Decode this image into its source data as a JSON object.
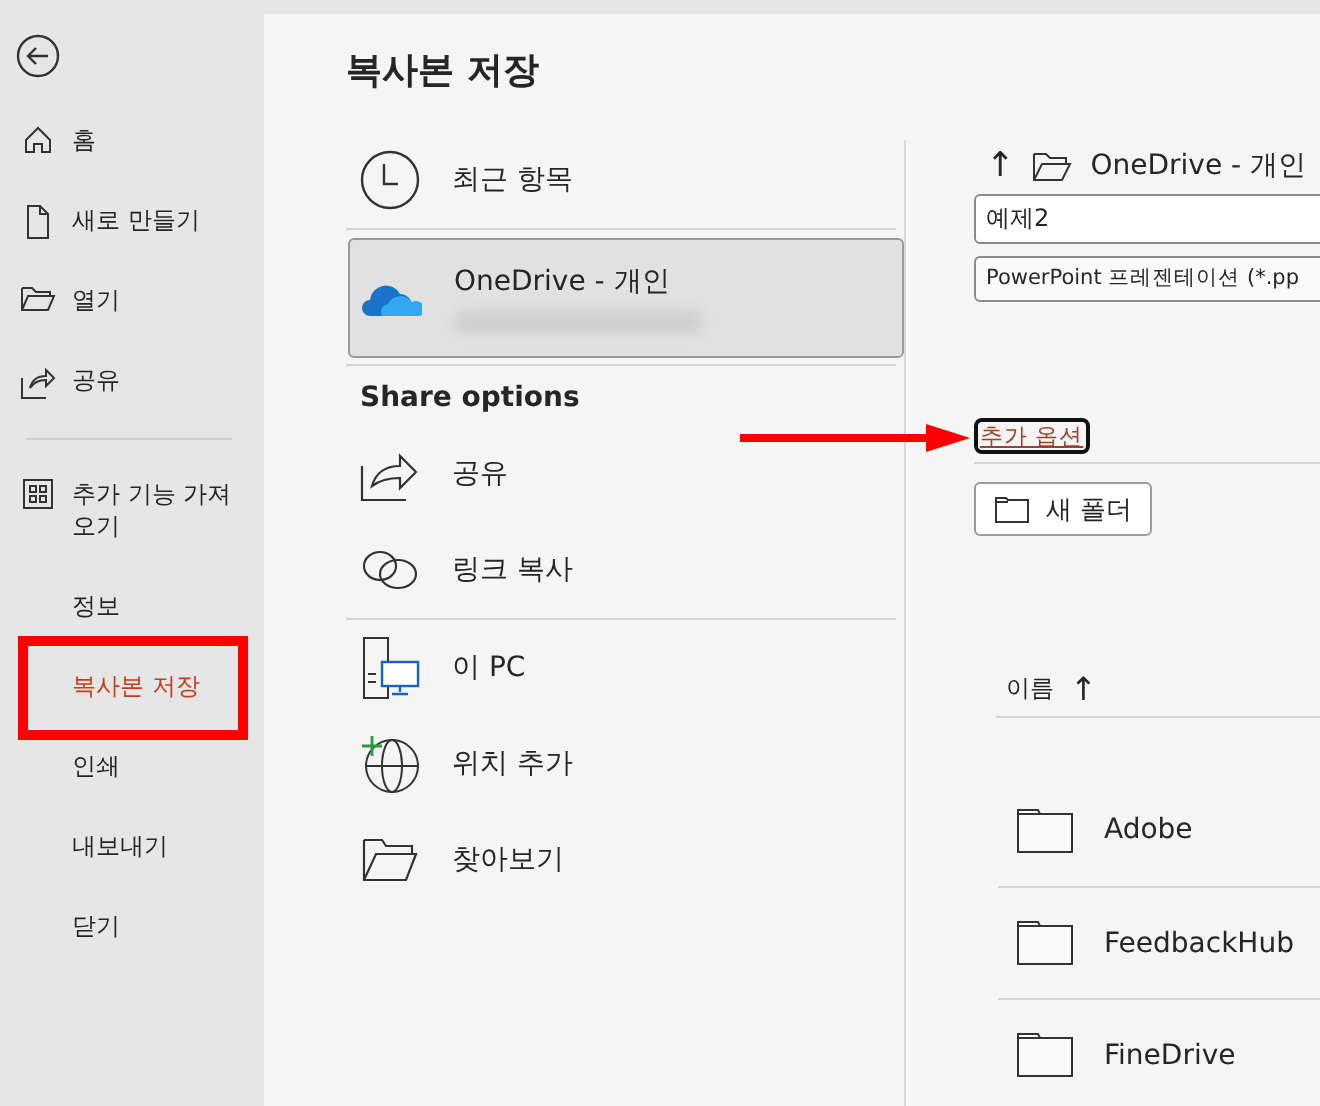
{
  "sidebar": {
    "items": [
      {
        "label": "홈",
        "kind": "home",
        "selected": false
      },
      {
        "label": "새로 만들기",
        "kind": "new",
        "selected": false
      },
      {
        "label": "열기",
        "kind": "open",
        "selected": false
      },
      {
        "label": "공유",
        "kind": "share",
        "selected": false
      },
      {
        "label": "추가 기능 가져오기",
        "kind": "addins",
        "selected": false
      },
      {
        "label": "정보",
        "kind": "plain",
        "selected": false
      },
      {
        "label": "복사본 저장",
        "kind": "plain",
        "selected": true
      },
      {
        "label": "인쇄",
        "kind": "plain",
        "selected": false
      },
      {
        "label": "내보내기",
        "kind": "plain",
        "selected": false
      },
      {
        "label": "닫기",
        "kind": "plain",
        "selected": false
      }
    ]
  },
  "page_title": "복사본 저장",
  "locations": {
    "items": [
      {
        "label": "최근 항목",
        "kind": "recent",
        "selected": false
      },
      {
        "label": "OneDrive - 개인",
        "kind": "onedrive",
        "selected": true
      }
    ],
    "share_heading": "Share options",
    "share_items": [
      {
        "label": "공유",
        "kind": "share"
      },
      {
        "label": "링크 복사",
        "kind": "link"
      }
    ],
    "other_items": [
      {
        "label": "이 PC",
        "kind": "pc"
      },
      {
        "label": "위치 추가",
        "kind": "addplace"
      },
      {
        "label": "찾아보기",
        "kind": "browse"
      }
    ]
  },
  "save": {
    "path": "OneDrive - 개인",
    "file_name": "예제2",
    "file_type": "PowerPoint 프레젠테이션 (*.pp",
    "more_options": "추가 옵션",
    "new_folder": "새 폴더",
    "column_header": "이름",
    "sort_arrow": "↑",
    "folders": [
      {
        "name": "Adobe"
      },
      {
        "name": "FeedbackHub"
      },
      {
        "name": "FineDrive"
      }
    ]
  }
}
